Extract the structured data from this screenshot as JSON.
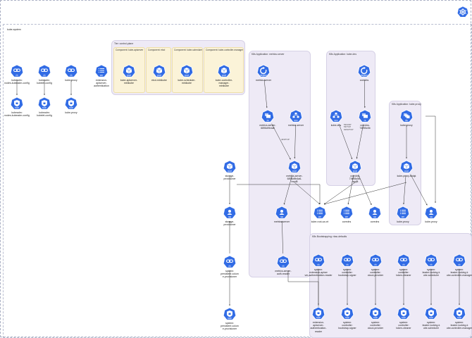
{
  "namespace": {
    "label": "kube-system"
  },
  "groups": {
    "control": "Tier: control-plane",
    "comp_apiserver": "Component: kube-apiserver",
    "comp_etcd": "Component: etcd",
    "comp_scheduler": "Component: kube-scheduler",
    "comp_ctrlmgr": "Component: kube-controller-manager",
    "metrics": "K8s Application: metrics-server",
    "coredns": "K8s Application: kube-dns",
    "proxy": "K8s Application: kube-proxy",
    "bootstrap": "K8s Bootstrapping: rbac-defaults"
  },
  "nodes": {
    "rb_kubeadm": {
      "kind": "rb",
      "label": "kubeadm:\nnodes-kubeadm-config"
    },
    "role_kubeadm": {
      "kind": "role",
      "label": "kubeadm:\nnodes-kubeadm-config"
    },
    "rb_kubelet": {
      "kind": "rb",
      "label": "kubeadm:\nkubelet-config"
    },
    "role_kubelet": {
      "kind": "role",
      "label": "kubeadm:\nkubelet-config"
    },
    "rb_kproxy": {
      "kind": "rb",
      "label": "kube-proxy"
    },
    "role_kproxy": {
      "kind": "role",
      "label": "kube-proxy"
    },
    "cm_ext": {
      "kind": "cm",
      "label": "extension-\napiserver-\nauthentication"
    },
    "pod_apiserver": {
      "kind": "pod",
      "label": "kube-apiserver-\nminikube"
    },
    "pod_etcd": {
      "kind": "pod",
      "label": "etcd-minikube"
    },
    "pod_sched": {
      "kind": "pod",
      "label": "kube-scheduler-\nminikube"
    },
    "pod_cm": {
      "kind": "pod",
      "label": "kube-controller-\nmanager-\nminikube"
    },
    "deploy_ms": {
      "kind": "deploy",
      "label": "metrics-server"
    },
    "rs_ms": {
      "kind": "rs",
      "label": "metrics-server-\n6896d9b4a6"
    },
    "svc_ms": {
      "kind": "svc",
      "label": "metrics-server"
    },
    "pod_ms": {
      "kind": "pod",
      "label": "metrics-server-\n6896d9b4a6-\nbsw8l"
    },
    "sa_ms": {
      "kind": "sa",
      "label": "metrics-server"
    },
    "rb_ms": {
      "kind": "rb",
      "label": "metrics-server-\nauth-reader"
    },
    "pod_storage": {
      "kind": "pod",
      "label": "storage-\nprovisioner"
    },
    "sa_storage": {
      "kind": "sa",
      "label": "storage-\nprovisioner"
    },
    "rb_storage": {
      "kind": "rb",
      "label": "system:\npersistent-volum\ne-provisioner"
    },
    "role_storage": {
      "kind": "role",
      "label": "system:\npersistent-volum\ne-provisioner"
    },
    "deploy_dns": {
      "kind": "deploy",
      "label": "coredns"
    },
    "svc_dns": {
      "kind": "svc",
      "label": "kube-dns"
    },
    "rs_dns": {
      "kind": "rs",
      "label": "coredns-\n74ff55c5b"
    },
    "pod_dns": {
      "kind": "pod",
      "label": "coredns-\n74ff55c5b-\nnqq8t"
    },
    "cm_rootca": {
      "kind": "cm",
      "label": "kube-root-ca.crt"
    },
    "cm_coredns": {
      "kind": "cm",
      "label": "coredns"
    },
    "sa_coredns": {
      "kind": "sa",
      "label": "coredns"
    },
    "ds_proxy": {
      "kind": "ds",
      "label": "kube-proxy"
    },
    "pod_proxy": {
      "kind": "pod",
      "label": "kube-proxy-tkdqk"
    },
    "cm_proxy": {
      "kind": "cm",
      "label": "kube-proxy"
    },
    "sa_proxy": {
      "kind": "sa",
      "label": "kube-proxy"
    },
    "rb_b1": {
      "kind": "rb",
      "label": "system:\nextension-apiser\nver-authentication-reader"
    },
    "rb_b2": {
      "kind": "rb",
      "label": "system:\ncontroller:\nbootstrap-signer"
    },
    "rb_b3": {
      "kind": "rb",
      "label": "system:\ncontroller:\ncloud-provider"
    },
    "rb_b4": {
      "kind": "rb",
      "label": "system:\ncontroller:\ntoken-cleaner"
    },
    "rb_b5": {
      "kind": "rb",
      "label": "system:\nleader-locking-k\nube-scheduler"
    },
    "rb_b6": {
      "kind": "rb",
      "label": "system:\nleader-locking-k\nube-controller-manager"
    },
    "role_b1": {
      "kind": "role",
      "label": "extension-\napiserver-\nauthentication-\nreader"
    },
    "role_b2": {
      "kind": "role",
      "label": "system:\ncontroller:\nbootstrap-signer"
    },
    "role_b3": {
      "kind": "role",
      "label": "system:\ncontroller:\ncloud-provider"
    },
    "role_b4": {
      "kind": "role",
      "label": "system:\ncontroller:\ntoken-cleaner"
    },
    "role_b5": {
      "kind": "role",
      "label": "system:\nleader-locking-k\nube-scheduler"
    },
    "role_b6": {
      "kind": "role",
      "label": "system:\nleader-locking-k\nube-controller-manager"
    }
  },
  "edge_labels": {
    "ms_port": "443/TCP",
    "dns_ports": "53/UDP\n53/TCP\n9153/TCP"
  },
  "colors": {
    "node": "#326ce5",
    "edge": "#333333",
    "group": "#eeeaf6",
    "component": "#fbf3d8"
  },
  "icons": {
    "k8s_logo": "kubernetes-helm-icon"
  }
}
